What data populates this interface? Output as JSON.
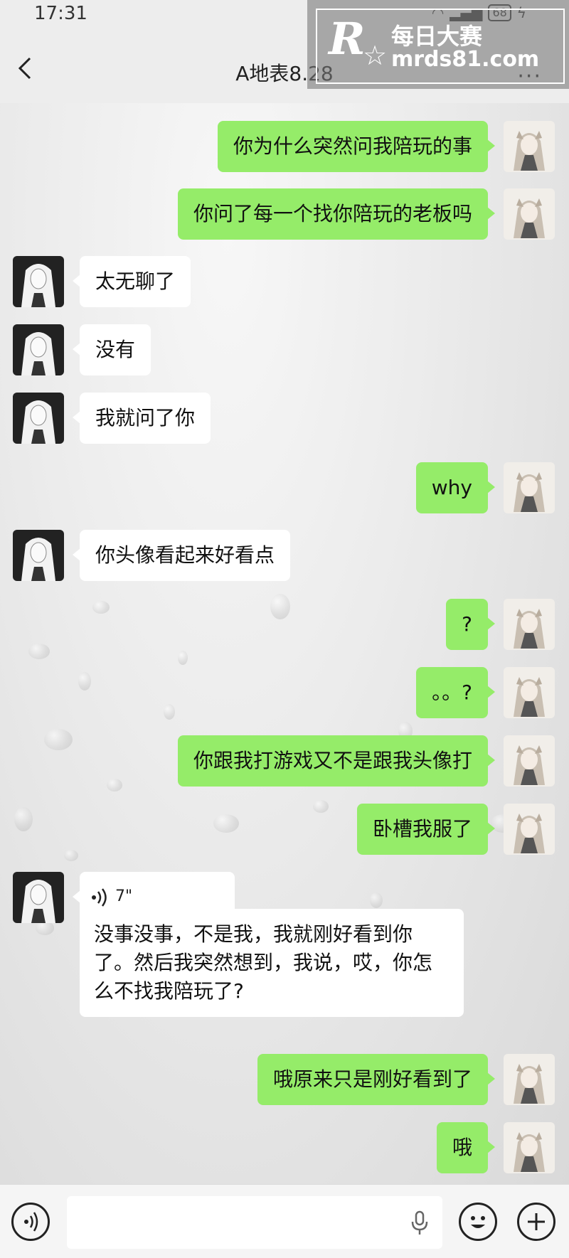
{
  "status": {
    "time": "17:31",
    "battery": "68"
  },
  "header": {
    "title": "A地表8.28",
    "more": "···"
  },
  "watermark": {
    "logo": "R",
    "site_cn": "每日大赛",
    "site_url": "mrds81.com"
  },
  "messages": [
    {
      "sender": "me",
      "text": "你为什么突然问我陪玩的事"
    },
    {
      "sender": "me",
      "text": "你问了每一个找你陪玩的老板吗"
    },
    {
      "sender": "them",
      "text": "太无聊了"
    },
    {
      "sender": "them",
      "text": "没有"
    },
    {
      "sender": "them",
      "text": "我就问了你"
    },
    {
      "sender": "me",
      "text": "why"
    },
    {
      "sender": "them",
      "text": "你头像看起来好看点"
    },
    {
      "sender": "me",
      "text": "?"
    },
    {
      "sender": "me",
      "text": "。。?"
    },
    {
      "sender": "me",
      "text": "你跟我打游戏又不是跟我头像打"
    },
    {
      "sender": "me",
      "text": "卧槽我服了"
    },
    {
      "sender": "them",
      "type": "voice",
      "duration": "7\""
    },
    {
      "sender": "them",
      "type": "transcript",
      "text": "没事没事，不是我，我就刚好看到你了。然后我突然想到，我说，哎，你怎么不找我陪玩了?"
    },
    {
      "sender": "me",
      "text": "哦原来只是刚好看到了"
    },
    {
      "sender": "me",
      "text": "哦"
    }
  ],
  "inputbar": {
    "placeholder": ""
  },
  "colors": {
    "my_bubble": "#95ec69",
    "their_bubble": "#ffffff",
    "bar": "#ededed"
  }
}
